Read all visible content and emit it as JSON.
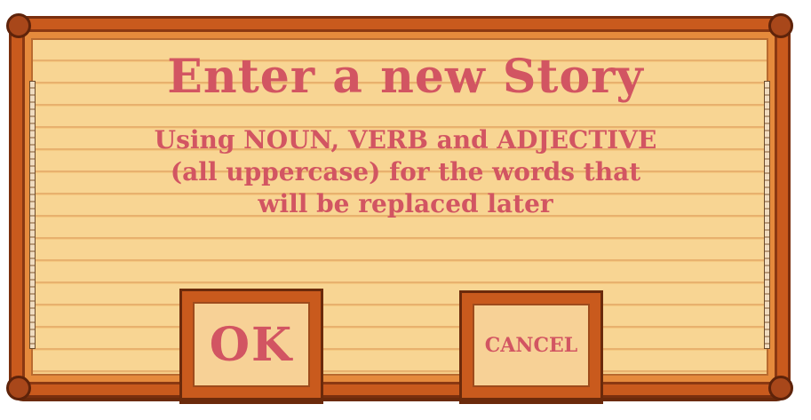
{
  "dialog": {
    "title": "Enter a new Story",
    "instructions": [
      "Using NOUN, VERB and ADJECTIVE",
      "(all uppercase) for the words that",
      "will be replaced later"
    ]
  },
  "buttons": {
    "ok_label": "OK",
    "cancel_label": "CANCEL"
  },
  "colors": {
    "text": "#d25562",
    "board": "#f7cf8c",
    "frame": "#c95a1d",
    "frame_dark": "#6b2a0b"
  }
}
